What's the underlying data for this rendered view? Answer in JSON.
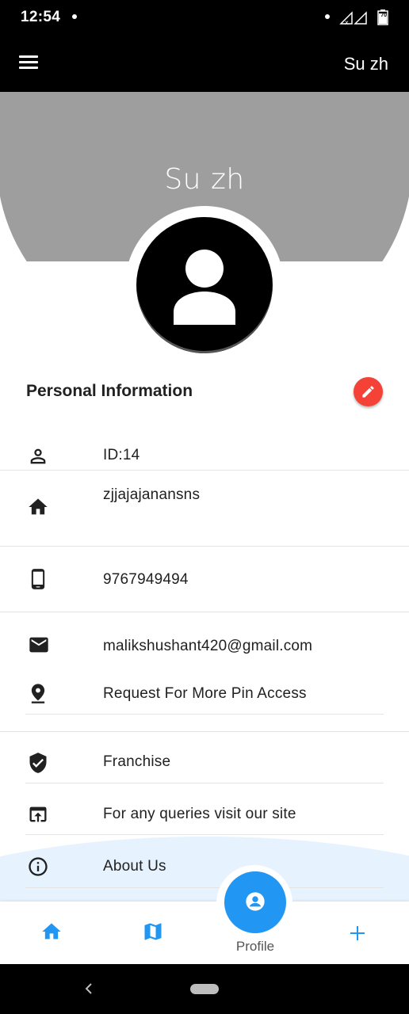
{
  "status_bar": {
    "time": "12:54",
    "battery": "70"
  },
  "app_bar": {
    "title": "Su zh",
    "menu_icon": "menu-icon"
  },
  "header": {
    "name": "Su zh",
    "avatar_icon": "person-icon"
  },
  "personal_info": {
    "title": "Personal Information",
    "edit_icon": "pencil-icon",
    "edit_color": "#f44336",
    "rows": [
      {
        "icon": "person-outline-icon",
        "text": "ID:14"
      },
      {
        "icon": "home-icon",
        "text": "zjjajajanansns"
      },
      {
        "icon": "smartphone-icon",
        "text": "9767949494"
      },
      {
        "icon": "mail-icon",
        "text": "malikshushant420@gmail.com"
      },
      {
        "icon": "location-pin-icon",
        "text": "Request For More Pin Access"
      },
      {
        "icon": "verified-shield-icon",
        "text": "Franchise"
      },
      {
        "icon": "open-in-browser-icon",
        "text": "For any queries visit our site"
      },
      {
        "icon": "info-icon",
        "text": "About Us"
      }
    ]
  },
  "bottom_nav": {
    "items": [
      {
        "icon": "home-icon"
      },
      {
        "icon": "map-icon"
      },
      {
        "icon": "profile-icon",
        "label": "Profile",
        "active": true
      },
      {
        "icon": "plus-icon"
      }
    ],
    "accent": "#2196f3"
  },
  "colors": {
    "header_gray": "#9e9e9e",
    "app_bar": "#000000"
  }
}
